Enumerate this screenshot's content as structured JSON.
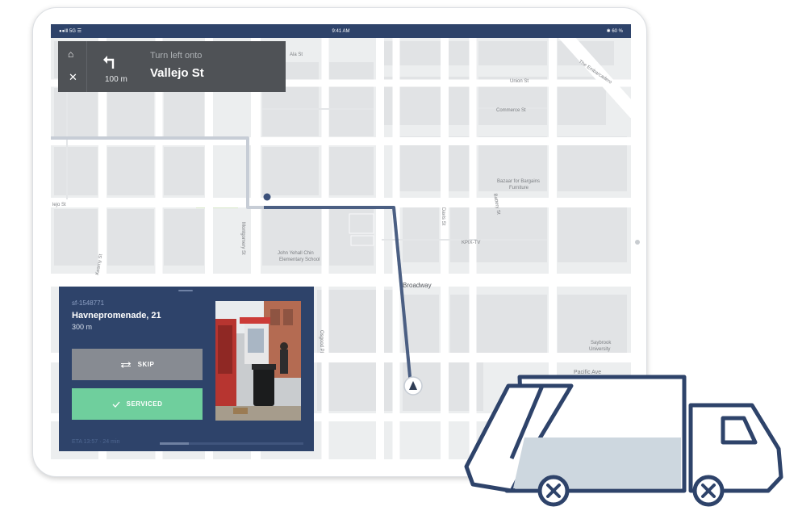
{
  "status_bar": {
    "left": "●●lll 5G ☰",
    "time": "9:41 AM",
    "right": "✱ 60 %"
  },
  "navigation": {
    "distance": "100 m",
    "instruction": "Turn left onto",
    "street": "Vallejo St"
  },
  "map_labels": {
    "ala_st": "Ala St",
    "union_st": "Union St",
    "embarcadero": "The Embarcadero",
    "commerce_st": "Commerce St",
    "jo_st": "lejo St",
    "bazaar": "Bazaar for Bargains",
    "furniture": "Furniture",
    "davis_st": "Davis St",
    "battery_st": "Battery St",
    "kpix": "KPIX-TV",
    "school_1": "John Yehall Chin",
    "school_2": "Elementary School",
    "montgomery": "Montgomery St",
    "broadway": "Broadway",
    "kearny": "Kearny St",
    "saybrook_1": "Saybrook",
    "saybrook_2": "University",
    "pacific": "Pacific Ave",
    "osgood": "Osgood Pl"
  },
  "stop": {
    "id": "sf-1548771",
    "address": "Havnepromenade, 21",
    "distance": "300 m",
    "skip_label": "SKIP",
    "serviced_label": "SERVICED",
    "eta": "ETA 13:57  ·  24 min",
    "progress": 0.2
  },
  "icons": {
    "home": "home-icon",
    "close": "close-icon",
    "turn": "turn-left-icon",
    "skip": "skip-arrows-icon",
    "check": "check-icon",
    "location": "location-arrow-icon",
    "truck": "garbage-truck-icon"
  },
  "colors": {
    "navy": "#2e436a",
    "route": "#4b5f83",
    "serviced": "#6fcf9d",
    "skip": "#878b92",
    "nav_banner": "#4f5256"
  }
}
